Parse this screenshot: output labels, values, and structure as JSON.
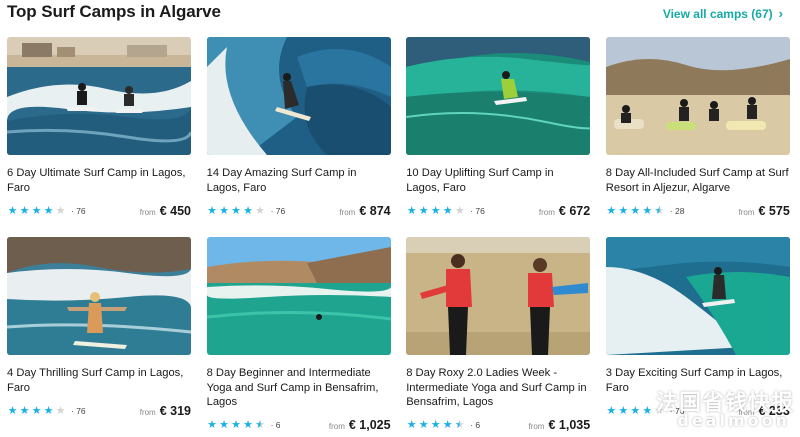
{
  "header": {
    "title": "Top Surf Camps in Algarve",
    "view_all_label": "View all camps (67)",
    "view_all_chevron": "›"
  },
  "colors": {
    "accent": "#17a9a6",
    "star": "#1ab0e6",
    "star_empty": "#d4d4d4"
  },
  "cards": [
    {
      "title": "6 Day Ultimate Surf Camp in Lagos, Faro",
      "rating": 4,
      "reviews": "· 76",
      "from": "from",
      "price": "€ 450"
    },
    {
      "title": "14 Day Amazing Surf Camp in Lagos, Faro",
      "rating": 4,
      "reviews": "· 76",
      "from": "from",
      "price": "€ 874"
    },
    {
      "title": "10 Day Uplifting Surf Camp in Lagos, Faro",
      "rating": 4,
      "reviews": "· 76",
      "from": "from",
      "price": "€ 672"
    },
    {
      "title": "8 Day All-Included Surf Camp at Surf Resort in Aljezur, Algarve",
      "rating": 4.5,
      "reviews": "· 28",
      "from": "from",
      "price": "€ 575"
    },
    {
      "title": "4 Day Thrilling Surf Camp in Lagos, Faro",
      "rating": 4,
      "reviews": "· 76",
      "from": "from",
      "price": "€ 319"
    },
    {
      "title": "8 Day Beginner and Intermediate Yoga and Surf Camp in Bensafrim, Lagos",
      "rating": 4.5,
      "reviews": "· 6",
      "from": "from",
      "price": "€ 1,025"
    },
    {
      "title": "8 Day Roxy 2.0 Ladies Week - Intermediate Yoga and Surf Camp in Bensafrim, Lagos",
      "rating": 4.5,
      "reviews": "· 6",
      "from": "from",
      "price": "€ 1,035"
    },
    {
      "title": "3 Day Exciting Surf Camp in Lagos, Faro",
      "rating": 4,
      "reviews": "· 76",
      "from": "from",
      "price": "€ 233"
    }
  ],
  "watermark": {
    "line1": "法国省钱快报",
    "line2": "dealmoon"
  }
}
